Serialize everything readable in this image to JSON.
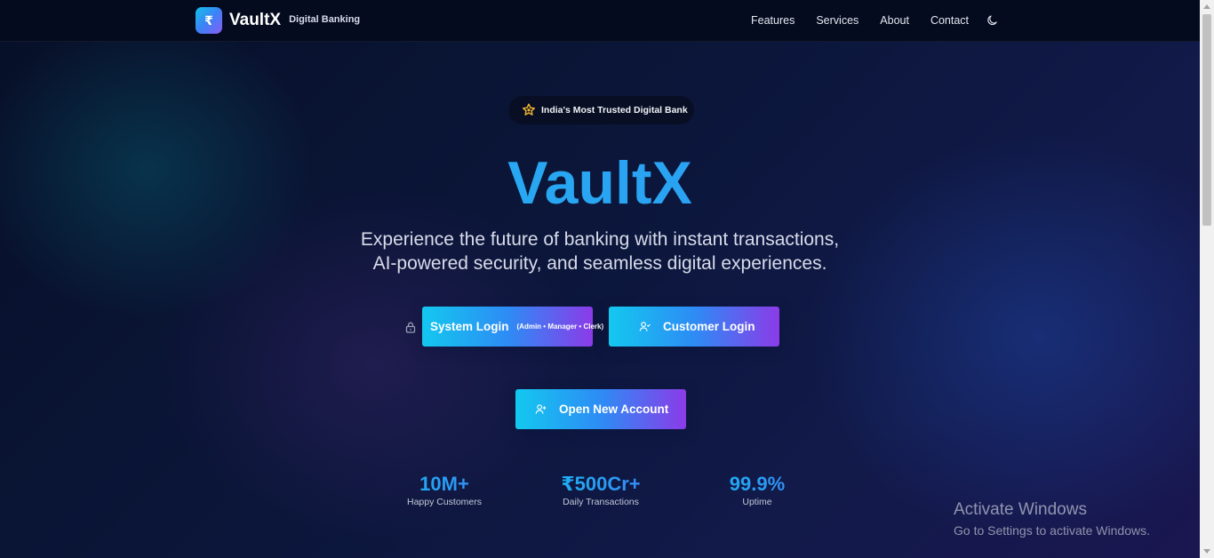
{
  "header": {
    "logo_symbol": "₹",
    "brand_name": "VaultX",
    "brand_tagline": "Digital Banking",
    "nav": [
      "Features",
      "Services",
      "About",
      "Contact"
    ],
    "theme_toggle_icon": "moon-icon"
  },
  "hero": {
    "badge_icon": "star-icon",
    "badge_text": "India's Most Trusted Digital Bank",
    "title": "VaultX",
    "subtitle_line1": "Experience the future of banking with instant transactions,",
    "subtitle_line2": "AI-powered security, and seamless digital experiences."
  },
  "actions": {
    "system_login": {
      "icon": "lock-icon",
      "label": "System Login",
      "hint": "(Admin • Manager • Clerk)"
    },
    "customer_login": {
      "icon": "user-icon",
      "label": "Customer Login"
    },
    "open_account": {
      "icon": "user-plus-icon",
      "label": "Open New Account"
    }
  },
  "stats": [
    {
      "value": "10M+",
      "label": "Happy Customers"
    },
    {
      "value": "₹500Cr+",
      "label": "Daily Transactions"
    },
    {
      "value": "99.9%",
      "label": "Uptime"
    }
  ],
  "watermark": {
    "title": "Activate Windows",
    "subtitle": "Go to Settings to activate Windows."
  },
  "colors": {
    "accent_cyan": "#13c8ef",
    "accent_blue": "#2d8cf5",
    "accent_purple": "#8b3be8",
    "background": "#0b1130"
  }
}
